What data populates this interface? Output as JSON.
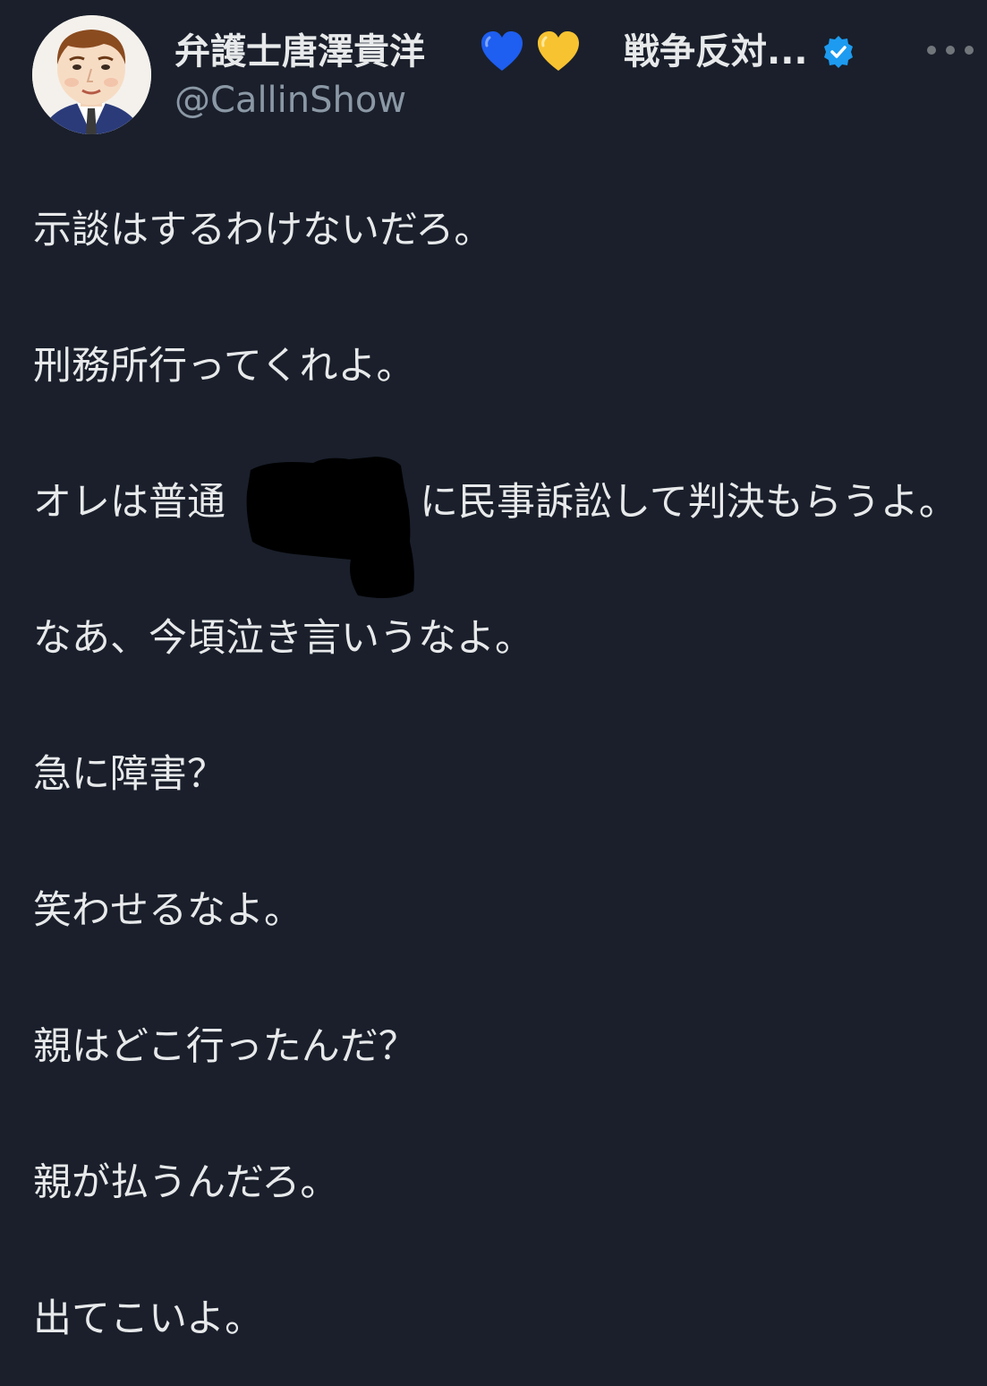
{
  "author": {
    "display_name": "弁護士唐澤貴洋",
    "name_suffix": "戦争反対...",
    "handle": "@CallinShow",
    "hearts": [
      "blue-heart-icon",
      "yellow-heart-icon"
    ],
    "verified": true
  },
  "tweet": {
    "lines": [
      "示談はするわけないだろ。",
      "刑務所行ってくれよ。",
      {
        "before_redaction": "オレは普通",
        "after_redaction": "に民事訴訟して判決もらうよ。"
      },
      "なあ、今頃泣き言いうなよ。",
      "急に障害？",
      "笑わせるなよ。",
      "親はどこ行ったんだ？",
      "親が払うんだろ。",
      "出てこいよ。"
    ]
  },
  "colors": {
    "background": "#1a1f2b",
    "text": "#e7e9ea",
    "secondary_text": "#8b98a5",
    "verified_badge": "#1d9bf0",
    "heart_blue": "#1e5ef0",
    "heart_yellow": "#f7c331"
  }
}
